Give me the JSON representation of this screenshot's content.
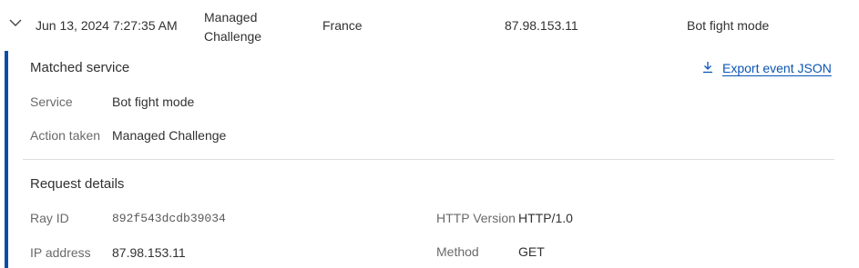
{
  "event_row": {
    "date": "Jun 13, 2024 7:27:35 AM",
    "action_line1": "Managed",
    "action_line2": "Challenge",
    "country": "France",
    "ip": "87.98.153.11",
    "service": "Bot fight mode"
  },
  "matched_service": {
    "title": "Matched service",
    "export_label": "Export event JSON",
    "service_label": "Service",
    "service_value": "Bot fight mode",
    "action_label": "Action taken",
    "action_value": "Managed Challenge"
  },
  "request_details": {
    "title": "Request details",
    "ray_id_label": "Ray ID",
    "ray_id_value": "892f543dcdb39034",
    "ip_label": "IP address",
    "ip_value": "87.98.153.11",
    "http_version_label": "HTTP Version",
    "http_version_value": "HTTP/1.0",
    "method_label": "Method",
    "method_value": "GET"
  },
  "icons": {
    "expand": "chevron-down-icon",
    "export": "download-icon"
  },
  "colors": {
    "accent_bar": "#0a4fa3",
    "link": "#0a55b4",
    "label_gray": "#6a6a6a",
    "text": "#313131",
    "divider": "#dedede"
  }
}
